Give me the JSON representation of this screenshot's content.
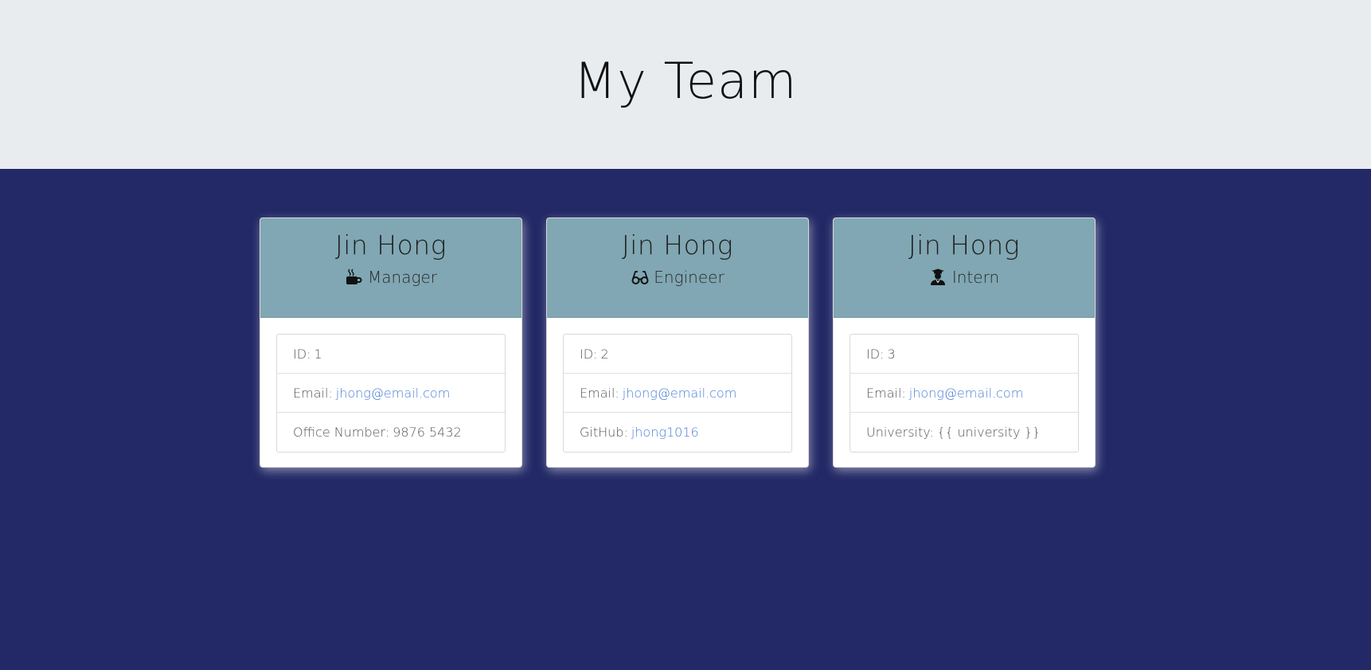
{
  "page": {
    "title": "My Team"
  },
  "members": [
    {
      "name": "Jin Hong",
      "role": "Manager",
      "icon": "coffee-icon",
      "id_label": "ID:",
      "id_value": "1",
      "email_label": "Email:",
      "email": "jhong@email.com",
      "extra_label": "Office Number:",
      "extra_value": "9876 5432"
    },
    {
      "name": "Jin Hong",
      "role": "Engineer",
      "icon": "glasses-icon",
      "id_label": "ID:",
      "id_value": "2",
      "email_label": "Email:",
      "email": "jhong@email.com",
      "extra_label": "GitHub:",
      "extra_value": "jhong1016"
    },
    {
      "name": "Jin Hong",
      "role": "Intern",
      "icon": "graduate-icon",
      "id_label": "ID:",
      "id_value": "3",
      "email_label": "Email:",
      "email": "jhong@email.com",
      "extra_label": "University:",
      "extra_value": "{{ university }}"
    }
  ],
  "colors": {
    "header_bg": "#e8ecef",
    "page_bg": "#232966",
    "card_head_bg": "#80a7b3",
    "link": "#4a7fd4"
  }
}
